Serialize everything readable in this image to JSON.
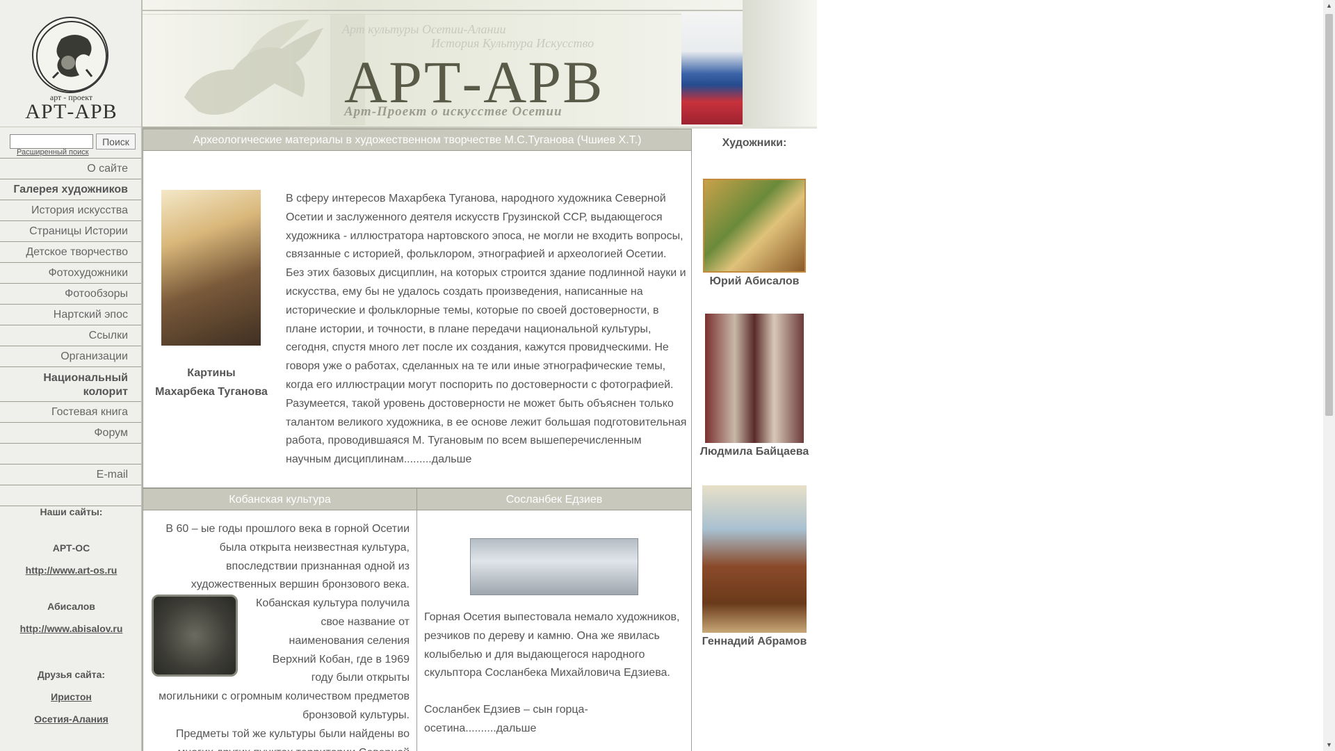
{
  "logo": {
    "subtitle": "арт - проект",
    "title": "АРТ-АРВ"
  },
  "search": {
    "value": "",
    "button": "Поиск",
    "advanced": "Расширенный поиск"
  },
  "menu": [
    {
      "label": "О сайте",
      "bold": false
    },
    {
      "label": "Галерея художников",
      "bold": true
    },
    {
      "label": "История искусства",
      "bold": false
    },
    {
      "label": "Страницы Истории",
      "bold": false
    },
    {
      "label": "Детское творчество",
      "bold": false
    },
    {
      "label": "Фотохудожники",
      "bold": false
    },
    {
      "label": "Фотообзоры",
      "bold": false
    },
    {
      "label": "Нартский эпос",
      "bold": false
    },
    {
      "label": "Ссылки",
      "bold": false
    },
    {
      "label": "Организации",
      "bold": false
    },
    {
      "label": "Национальный колорит",
      "bold": true
    },
    {
      "label": "Гостевая книга",
      "bold": false
    },
    {
      "label": "Форум",
      "bold": false
    },
    {
      "label": "",
      "bold": false
    },
    {
      "label": "E-mail",
      "bold": false
    },
    {
      "label": "",
      "bold": false
    }
  ],
  "sites": {
    "heading": "Наши сайты:",
    "site1_name": "АРТ-ОС",
    "site1_url": "http://www.art-os.ru",
    "site2_name": "Абисалов",
    "site2_url": "http://www.abisalov.ru",
    "friends_heading": "Друзья сайта:",
    "friend1": "Иристон",
    "friend2": "Осетия-Алания"
  },
  "banner": {
    "tagline1": "Арт культуры Осетии-Алании",
    "tagline2": "История Культура Искусство",
    "title": "АРТ-АРВ",
    "subtitle": "Арт-Проект о искусстве Осетии"
  },
  "feature": {
    "heading": "Археологические материалы в художественном творчестве М.С.Туганова (Чшиев Х.Т.)",
    "caption_line1": "Картины",
    "caption_line2": "Махарбека Туганова",
    "text": "В сферу интересов Махарбека Туганова, народного художника Северной Осетии и заслуженного деятеля искусств Грузинской ССР, выдающегося художника - иллюстратора нартовского эпоса, не могли не входить вопросы, связанные с историей, фольклором, этнографией и археологией Осетии. Без этих базовых дисциплин, на которых строится здание подлинной науки и искусства, ему бы не удалось создать произведения, написанные на исторические и фольклорные темы, которые по своей достоверности, в плане истории, и точности, в плане передачи национальной культуры, сегодня, спустя много лет после их создания, кажутся провидческими. Не говоря уже о работах, сделанных на те или иные этнографические темы, когда его иллюстрации могут поспорить по достоверности с фотографией. Разумеется, такой уровень достоверности не может быть объяснен только талантом великого художника, в ее основе лежит большая подготовительная работа, проводившаяся М. Тугановым по всем вышеперечисленным научным дисциплинам.........дальше"
  },
  "kobanskaya": {
    "heading": "Кобанская культура",
    "text1": "В 60 – ые годы прошлого века в горной Осетии была открыта неизвестная культура, впоследствии признанная одной из художественных вершин бронзового века.",
    "text2": "Кобанская культура получила свое название от наименования селения Верхний Кобан, где в 1969 году были открыты могильники с огромным количеством предметов бронзовой культуры.",
    "text3": "Предметы той же культуры были найдены во многих других пунктах территории Северной Осетии (в урочище \"Фаскау\" близ селения"
  },
  "edziev": {
    "heading": "Сосланбек Едзиев",
    "text1": "Горная Осетия выпестовала немало художников, резчиков по дереву и камню. Она же явилась колыбелью и для выдающегося народного скульптора Сосланбека Михайловича Едзиева.",
    "text2": "Сосланбек Едзиев – сын горца-осетина..........дальше"
  },
  "artists": {
    "heading": "Художники:",
    "a1": "Юрий Абисалов",
    "a2": "Людмила Байцаева",
    "a3": "Геннадий Абрамов"
  }
}
